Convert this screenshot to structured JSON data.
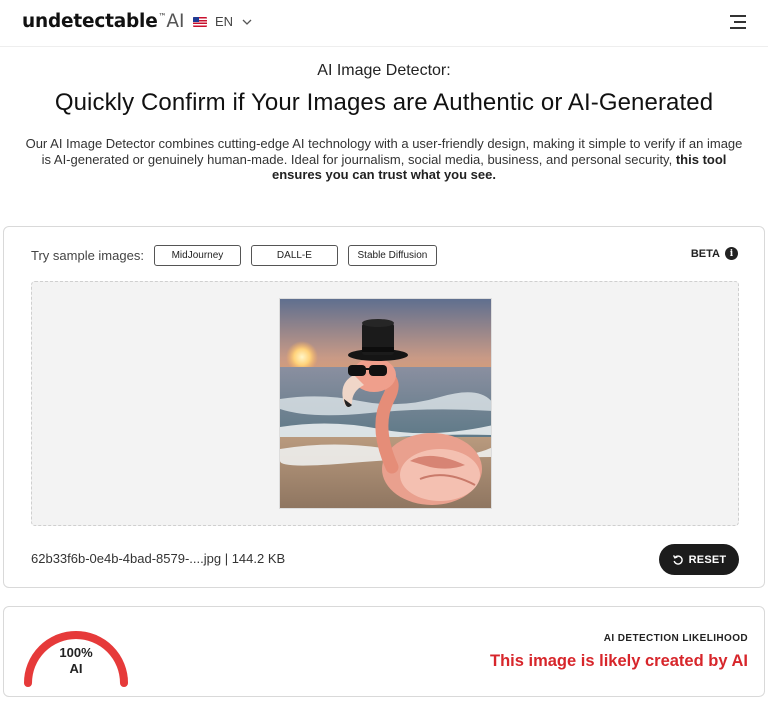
{
  "header": {
    "logo_text": "undetectable",
    "logo_tm": "™",
    "logo_suffix": "AI",
    "language": "EN"
  },
  "hero": {
    "kicker": "AI Image Detector:",
    "title": "Quickly Confirm if Your Images are Authentic or AI-Generated",
    "description_plain": "Our AI Image Detector combines cutting-edge AI technology with a user-friendly design, making it simple to verify if an image is AI-generated or genuinely human-made. Ideal for journalism, social media, business, and personal security,",
    "description_bold": "this tool ensures you can trust what you see."
  },
  "detector": {
    "samples_label": "Try sample images:",
    "samples": [
      "MidJourney",
      "DALL-E",
      "Stable Diffusion"
    ],
    "badge": "BETA",
    "file_info": "62b33f6b-0e4b-4bad-8579-....jpg | 144.2 KB",
    "reset_label": "RESET"
  },
  "result": {
    "percent": "100%",
    "percent_value": 100,
    "verdict_short": "AI",
    "label": "AI DETECTION LIKELIHOOD",
    "message": "This image is likely created by AI"
  },
  "colors": {
    "accent_red": "#d7262b",
    "dark_button": "#1c1c1c"
  },
  "icons": [
    "us-flag-icon",
    "chevron-down-icon",
    "hamburger-menu-icon",
    "info-icon",
    "reset-icon"
  ]
}
